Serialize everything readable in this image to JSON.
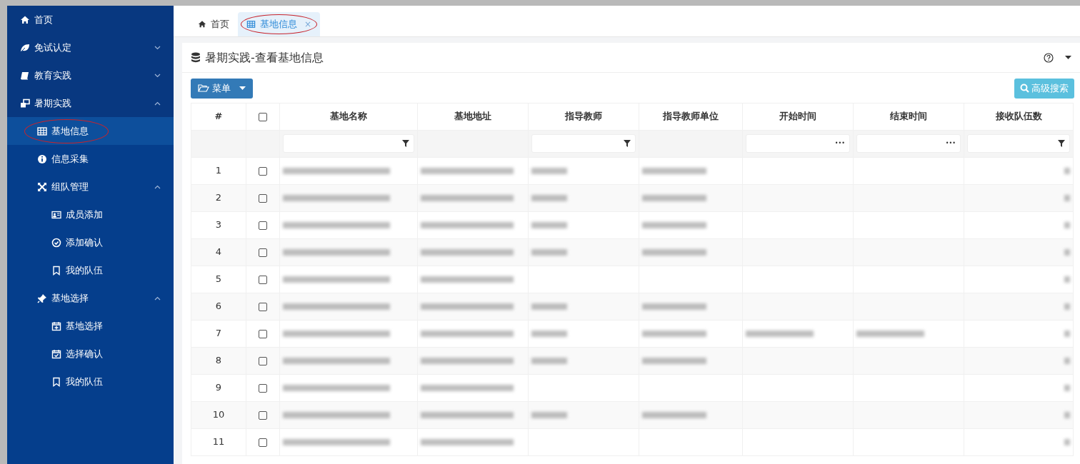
{
  "sidebar": {
    "items": [
      {
        "label": "首页",
        "selected": false
      },
      {
        "label": "免试认定",
        "selected": false,
        "expanded": false
      },
      {
        "label": "教育实践",
        "selected": false,
        "expanded": false
      },
      {
        "label": "暑期实践",
        "selected": false,
        "expanded": true,
        "children": [
          {
            "label": "基地信息",
            "selected": true,
            "circled": true
          },
          {
            "label": "信息采集",
            "selected": false
          },
          {
            "label": "组队管理",
            "selected": false,
            "expanded": true,
            "children": [
              {
                "label": "成员添加",
                "selected": false
              },
              {
                "label": "添加确认",
                "selected": false
              },
              {
                "label": "我的队伍",
                "selected": false
              }
            ]
          },
          {
            "label": "基地选择",
            "selected": false,
            "expanded": true,
            "children": [
              {
                "label": "基地选择",
                "selected": false
              },
              {
                "label": "选择确认",
                "selected": false
              },
              {
                "label": "我的队伍",
                "selected": false
              }
            ]
          }
        ]
      }
    ]
  },
  "tabs": [
    {
      "label": "首页",
      "selected": false,
      "closable": false,
      "circled": false
    },
    {
      "label": "基地信息",
      "selected": true,
      "closable": true,
      "circled": true
    }
  ],
  "close_glyph": "×",
  "panel": {
    "title": "暑期实践-查看基地信息"
  },
  "toolbar": {
    "menu_button": "菜单",
    "search_button": "高级搜索"
  },
  "table": {
    "columns": [
      {
        "label": "#"
      },
      {
        "kind": "checkbox"
      },
      {
        "label": "基地名称"
      },
      {
        "label": "基地地址"
      },
      {
        "label": "指导教师"
      },
      {
        "label": "指导教师单位"
      },
      {
        "label": "开始时间"
      },
      {
        "label": "结束时间"
      },
      {
        "label": "接收队伍数"
      }
    ],
    "header_checked": false,
    "filter_row": [
      {
        "kind": "blank"
      },
      {
        "kind": "blank"
      },
      {
        "kind": "funnel"
      },
      {
        "kind": "blank"
      },
      {
        "kind": "funnel"
      },
      {
        "kind": "blank"
      },
      {
        "kind": "picker"
      },
      {
        "kind": "picker"
      },
      {
        "kind": "funnel"
      }
    ],
    "picker_glyph": "•••",
    "rows": [
      {
        "number": "1",
        "checked": false,
        "blurred": [
          true,
          true,
          true,
          true,
          false,
          false,
          true
        ]
      },
      {
        "number": "2",
        "checked": false,
        "blurred": [
          true,
          true,
          true,
          true,
          false,
          false,
          true
        ]
      },
      {
        "number": "3",
        "checked": false,
        "blurred": [
          true,
          true,
          true,
          true,
          false,
          false,
          true
        ]
      },
      {
        "number": "4",
        "checked": false,
        "blurred": [
          true,
          true,
          true,
          true,
          false,
          false,
          true
        ]
      },
      {
        "number": "5",
        "checked": false,
        "blurred": [
          true,
          true,
          false,
          false,
          false,
          false,
          true
        ]
      },
      {
        "number": "6",
        "checked": false,
        "blurred": [
          true,
          true,
          true,
          true,
          false,
          false,
          true
        ]
      },
      {
        "number": "7",
        "checked": false,
        "blurred": [
          true,
          true,
          true,
          true,
          true,
          true,
          true
        ]
      },
      {
        "number": "8",
        "checked": false,
        "blurred": [
          true,
          true,
          true,
          true,
          false,
          false,
          true
        ]
      },
      {
        "number": "9",
        "checked": false,
        "blurred": [
          true,
          true,
          false,
          false,
          false,
          false,
          true
        ]
      },
      {
        "number": "10",
        "checked": false,
        "blurred": [
          true,
          true,
          true,
          true,
          false,
          false,
          true
        ]
      },
      {
        "number": "11",
        "checked": false,
        "blurred": [
          true,
          true,
          false,
          false,
          false,
          false,
          true
        ]
      }
    ]
  }
}
